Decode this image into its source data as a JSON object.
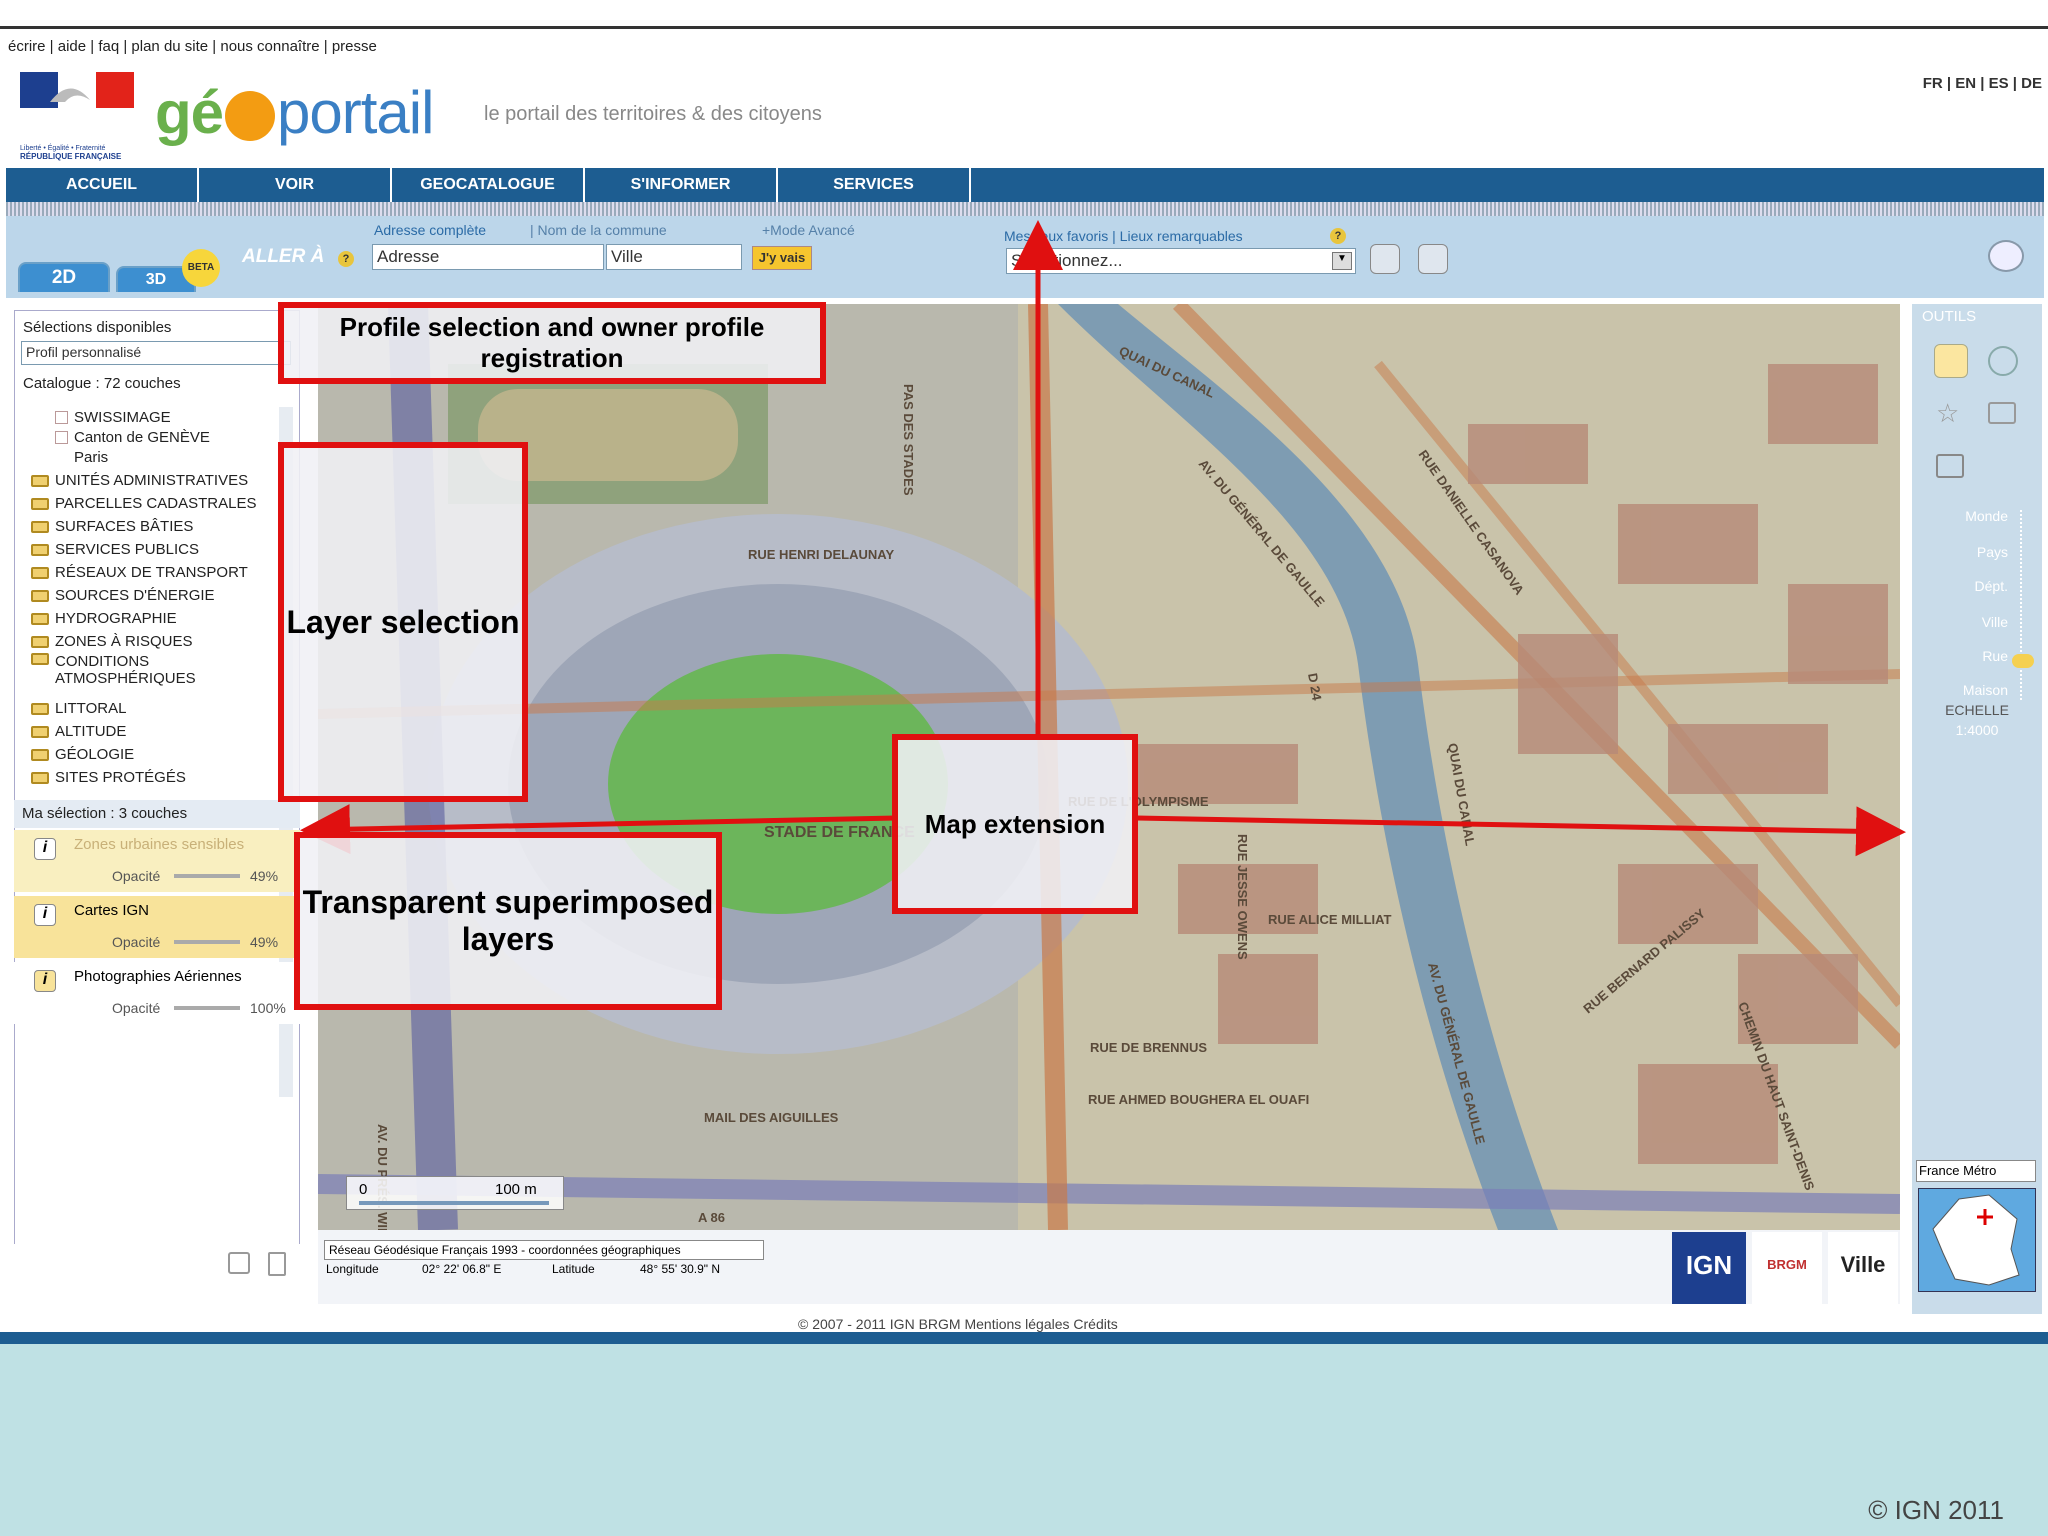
{
  "top_links": "écrire | aide | faq | plan du site | nous connaître | presse",
  "languages": "FR | EN | ES | DE",
  "logo": {
    "brand_prefix": "gé",
    "brand_suffix": "portail",
    "tagline": "le portail des territoires & des citoyens",
    "republic": "RÉPUBLIQUE FRANÇAISE",
    "motto": "Liberté • Égalité • Fraternité"
  },
  "nav": [
    "ACCUEIL",
    "VOIR",
    "GEOCATALOGUE",
    "S'INFORMER",
    "SERVICES"
  ],
  "toolbar": {
    "tab_2d": "2D",
    "tab_3d": "3D",
    "beta": "BETA",
    "aller_a": "ALLER À",
    "address_label": "Adresse complète",
    "commune_label": "| Nom de la commune",
    "mode_avance": "+Mode Avancé",
    "address_placeholder": "Adresse",
    "ville_placeholder": "Ville",
    "jyvais": "J'y vais",
    "favoris_label": "Mes lieux favoris | Lieux remarquables",
    "favoris_select": "Sélectionnez..."
  },
  "left_panel": {
    "selections_title": "Sélections disponibles",
    "profile_select": "Profil personnalisé",
    "catalogue": "Catalogue : 72 couches",
    "sub_items": [
      "SWISSIMAGE",
      "Canton de GENÈVE",
      "Paris"
    ],
    "folders": [
      "UNITÉS ADMINISTRATIVES",
      "PARCELLES CADASTRALES",
      "SURFACES BÂTIES",
      "SERVICES PUBLICS",
      "RÉSEAUX DE TRANSPORT",
      "SOURCES D'ÉNERGIE",
      "HYDROGRAPHIE",
      "ZONES À RISQUES",
      "CONDITIONS ATMOSPHÉRIQUES",
      "LITTORAL",
      "ALTITUDE",
      "GÉOLOGIE",
      "SITES PROTÉGÉS"
    ],
    "my_selection": "Ma sélection : 3 couches",
    "opacity_label": "Opacité",
    "layers": [
      {
        "name": "Zones urbaines sensibles",
        "opacity": "49%"
      },
      {
        "name": "Cartes IGN",
        "opacity": "49%"
      },
      {
        "name": "Photographies Aériennes",
        "opacity": "100%"
      }
    ]
  },
  "map": {
    "labels": [
      "QUAI DU CANAL",
      "AV. DU GÉNÉRAL DE GAULLE",
      "RUE HENRI DELAUNAY",
      "PAS DES STADES",
      "STADE DE FRANCE",
      "RUE DE L'OLYMPISME",
      "RUE JESSE OWENS",
      "RUE ALICE MILLIAT",
      "RUE DE BRENNUS",
      "RUE AHMED BOUGHERA EL OUAFI",
      "MAIL DES AIGUILLES",
      "RUE DANIELLE CASANOVA",
      "QUAI DU CANAL",
      "RUE BERNARD PALISSY",
      "CHEMIN DU HAUT SAINT-DENIS",
      "AV. DU GÉNÉRAL DE GAULLE",
      "D 24",
      "A 86",
      "AV. DU PRÉS. WILSON"
    ],
    "scale_start": "0",
    "scale_end": "100 m"
  },
  "coords": {
    "system": "Réseau Géodésique Français 1993 - coordonnées géographiques",
    "longitude_label": "Longitude",
    "longitude": "02° 22' 06.8\" E",
    "latitude_label": "Latitude",
    "latitude": "48° 55' 30.9\" N"
  },
  "right_panel": {
    "outils": "OUTILS",
    "zoom_levels": [
      "Monde",
      "Pays",
      "Dépt.",
      "Ville",
      "Rue",
      "Maison"
    ],
    "echelle_label": "ECHELLE",
    "echelle_value": "1:4000",
    "region_select": "France Métro"
  },
  "partner_logos": [
    "IGN",
    "BRGM",
    "Ville"
  ],
  "footer": {
    "copyright": "© 2007 - 2011 IGN BRGM Mentions légales Crédits",
    "slide_copyright": "© IGN 2011"
  },
  "callouts": {
    "profile": "Profile selection and owner profile registration",
    "layer": "Layer selection",
    "transparent": "Transparent superimposed layers",
    "map_ext": "Map extension"
  },
  "colors": {
    "nav": "#1d5d91",
    "callout": "#e01010",
    "toolbar": "#bcd6ea"
  }
}
